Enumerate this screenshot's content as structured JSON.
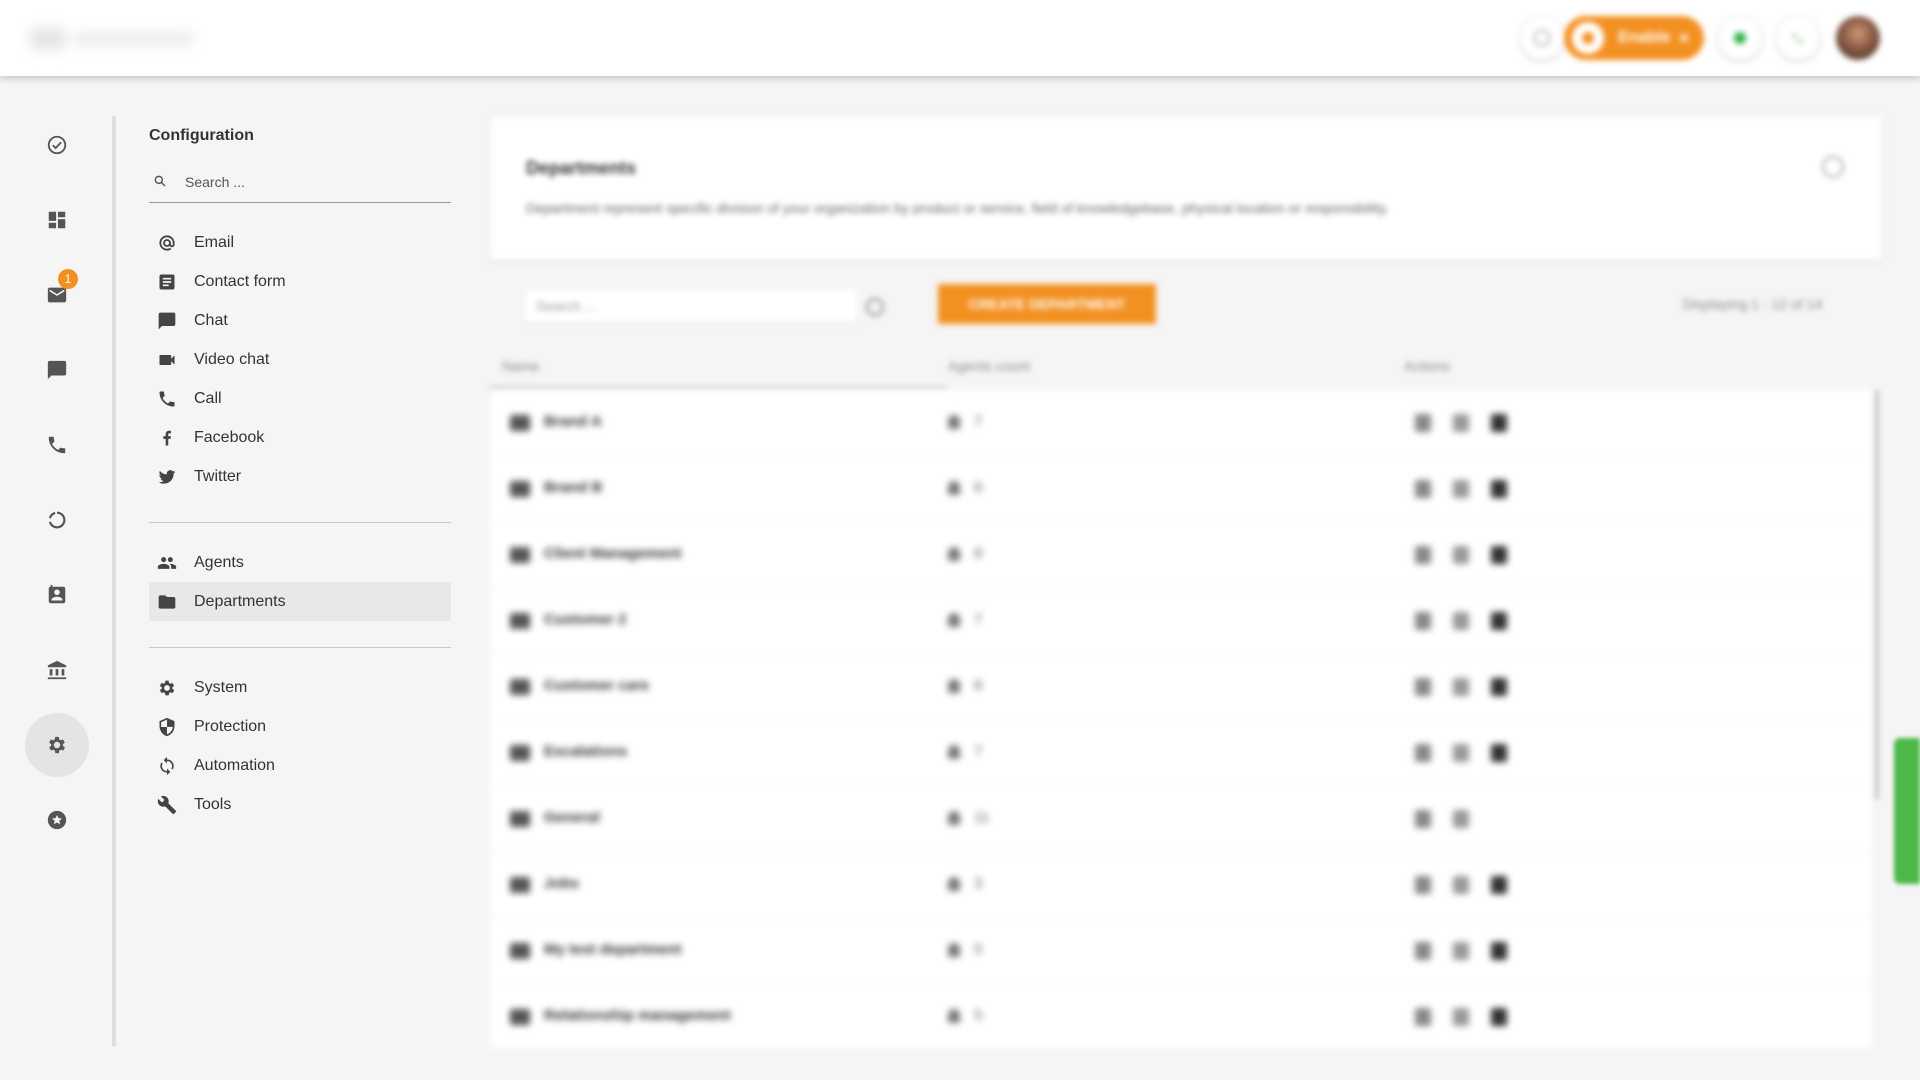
{
  "topbar": {
    "enable_label": "Enable",
    "enable_close": "✕"
  },
  "rail": {
    "mail_badge": "1",
    "items": [
      "check-circle-icon",
      "dashboard-icon",
      "mail-icon",
      "chat-icon",
      "phone-icon",
      "reports-icon",
      "contacts-icon",
      "bank-icon",
      "gear-icon",
      "star-icon"
    ],
    "active": "gear-icon"
  },
  "config": {
    "title": "Configuration",
    "search_placeholder": "Search ...",
    "channels": [
      {
        "label": "Email",
        "icon": "at-icon"
      },
      {
        "label": "Contact form",
        "icon": "form-icon"
      },
      {
        "label": "Chat",
        "icon": "chat-icon"
      },
      {
        "label": "Video chat",
        "icon": "video-icon"
      },
      {
        "label": "Call",
        "icon": "phone-icon"
      },
      {
        "label": "Facebook",
        "icon": "facebook-icon"
      },
      {
        "label": "Twitter",
        "icon": "twitter-icon"
      }
    ],
    "people": [
      {
        "label": "Agents",
        "icon": "people-icon"
      },
      {
        "label": "Departments",
        "icon": "folder-icon",
        "selected": true
      }
    ],
    "system": [
      {
        "label": "System",
        "icon": "gear-icon"
      },
      {
        "label": "Protection",
        "icon": "shield-icon"
      },
      {
        "label": "Automation",
        "icon": "sync-icon"
      },
      {
        "label": "Tools",
        "icon": "wrench-icon"
      }
    ]
  },
  "main": {
    "title": "Departments",
    "description": "Department represent specific division of your organization by product or service, field of knowledgebase, physical location or responsibility.",
    "search_placeholder": "Search ...",
    "create_button": "CREATE DEPARTMENT",
    "paging": "Displaying 1 - 12 of 14",
    "columns": [
      "Name",
      "Agents count",
      "Actions"
    ],
    "rows": [
      {
        "name": "Brand A",
        "count": "7"
      },
      {
        "name": "Brand B",
        "count": "6"
      },
      {
        "name": "Client Management",
        "count": "8"
      },
      {
        "name": "Customer 2",
        "count": "7"
      },
      {
        "name": "Customer care",
        "count": "8"
      },
      {
        "name": "Escalations",
        "count": "7"
      },
      {
        "name": "General",
        "count": "11"
      },
      {
        "name": "Jobs",
        "count": "3"
      },
      {
        "name": "My test department",
        "count": "5"
      },
      {
        "name": "Relationship management",
        "count": "5"
      }
    ]
  },
  "colors": {
    "accent": "#f39022",
    "online": "#2fb34a",
    "feedback": "#4cb848"
  }
}
